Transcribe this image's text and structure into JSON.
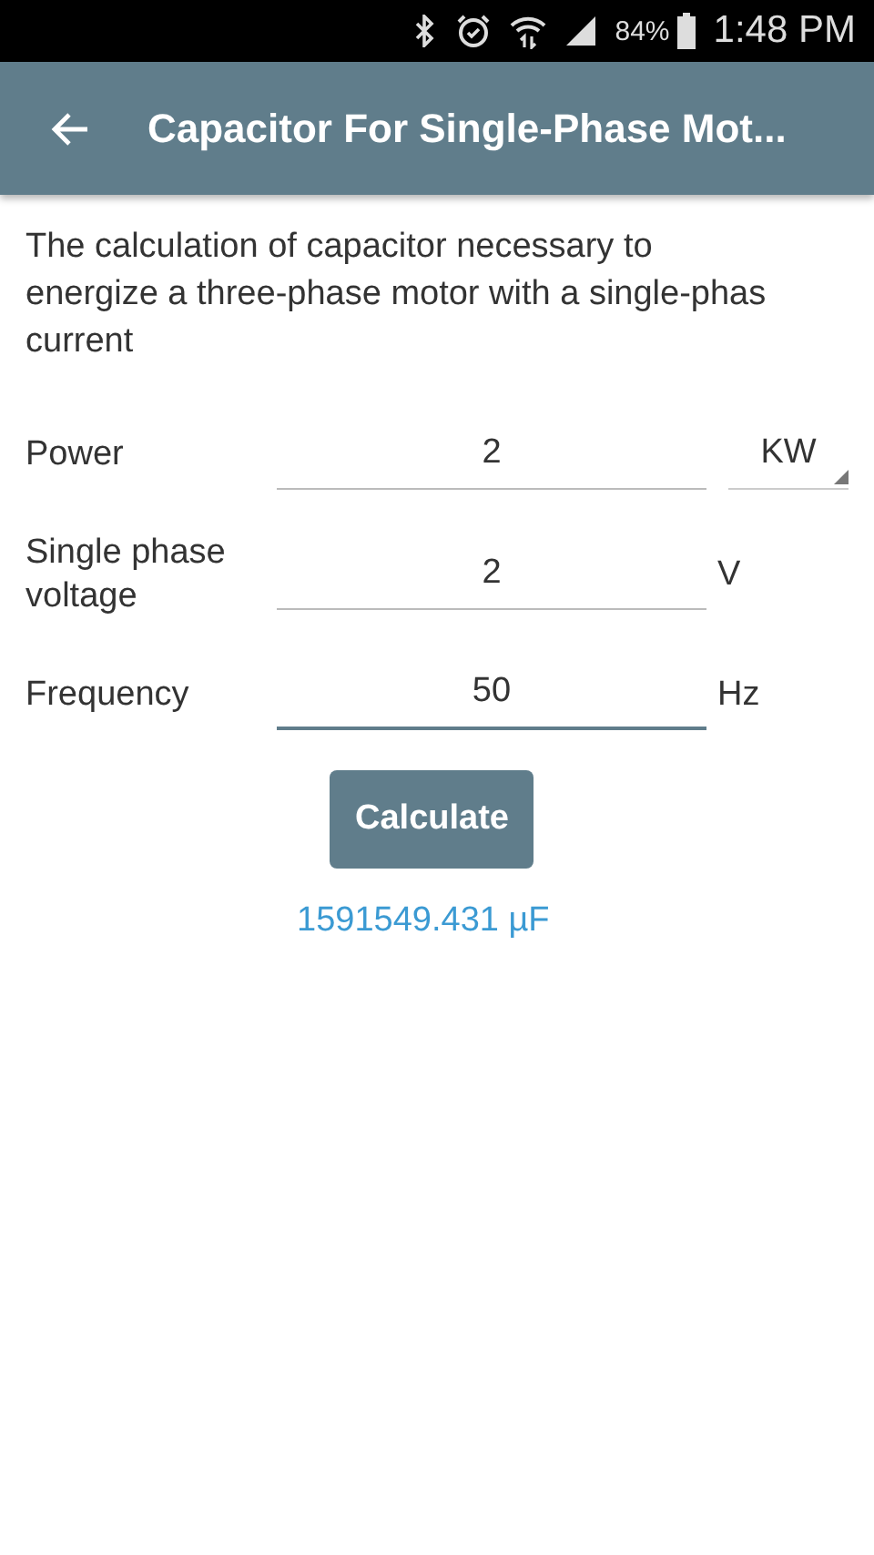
{
  "status_bar": {
    "battery": "84%",
    "time": "1:48 PM"
  },
  "app_bar": {
    "title": "Capacitor For Single-Phase Mot..."
  },
  "description_lines": [
    "The calculation of capacitor necessary to",
    "energize a three-phase motor with a single-phas",
    "current"
  ],
  "fields": [
    {
      "label": "Power",
      "value": "2",
      "unit": "KW",
      "kind": "dropdown",
      "focused": false
    },
    {
      "label": "Single phase voltage",
      "value": "2",
      "unit": "V",
      "kind": "text",
      "focused": false
    },
    {
      "label": "Frequency",
      "value": "50",
      "unit": "Hz",
      "kind": "text",
      "focused": true
    }
  ],
  "button": "Calculate",
  "result": "1591549.431 µF"
}
